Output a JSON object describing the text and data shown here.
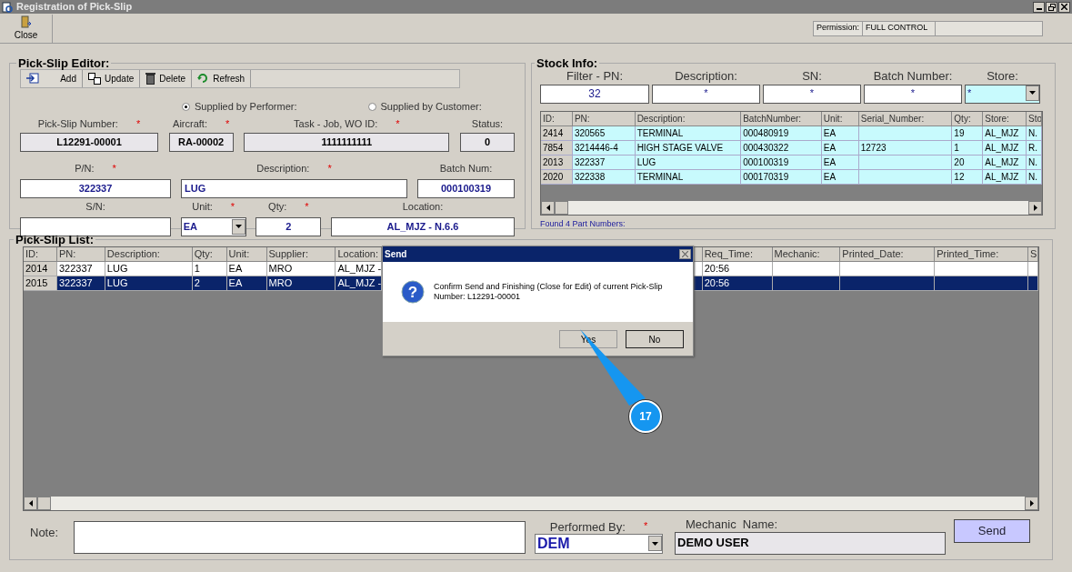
{
  "window": {
    "title": "Registration of Pick-Slip"
  },
  "toolbar": {
    "buttons": [
      {
        "label": "Close"
      }
    ]
  },
  "permission": {
    "label": "Permission:",
    "value": "FULL CONTROL"
  },
  "editor": {
    "title": "Pick-Slip Editor:",
    "actions": [
      {
        "kind": "add",
        "label": "Add"
      },
      {
        "kind": "update",
        "label": "Update"
      },
      {
        "kind": "delete",
        "label": "Delete"
      },
      {
        "kind": "refresh",
        "label": "Refresh"
      }
    ],
    "supply_options": [
      {
        "label": "Supplied by Performer:",
        "selected": true
      },
      {
        "label": "Supplied by Customer:",
        "selected": false
      }
    ],
    "rows": [
      [
        {
          "label": "Pick-Slip Number:",
          "required": true,
          "kind": "readonly",
          "value": "L12291-00001"
        },
        {
          "label": "Aircraft:",
          "required": true,
          "kind": "readonly",
          "value": "RA-00002"
        },
        {
          "label": "Task - Job, WO ID:",
          "required": true,
          "kind": "readonly",
          "value": "1111111111"
        },
        {
          "label": "Status:",
          "required": false,
          "kind": "readonly",
          "value": "0"
        }
      ],
      [
        {
          "label": "P/N:",
          "required": true,
          "kind": "input",
          "value": "322337"
        },
        {
          "label": "Description:",
          "required": true,
          "kind": "input",
          "value": "LUG"
        },
        {
          "label": "Batch Num:",
          "required": false,
          "kind": "input",
          "value": "000100319"
        }
      ],
      [
        {
          "label": "S/N:",
          "required": false,
          "kind": "input"
        },
        {
          "label": "Unit:",
          "required": true,
          "kind": "select",
          "value": "EA"
        },
        {
          "label": "Qty:",
          "required": true,
          "kind": "input",
          "value": "2"
        },
        {
          "label": "Location:",
          "required": false,
          "kind": "input",
          "value": "AL_MJZ - N.6.6"
        }
      ]
    ]
  },
  "stock": {
    "title": "Stock Info:",
    "filters": [
      {
        "label": "Filter - PN:",
        "value": "32",
        "kind": "input"
      },
      {
        "label": "Description:",
        "value": "*",
        "kind": "input"
      },
      {
        "label": "SN:",
        "value": "*",
        "kind": "input"
      },
      {
        "label": "Batch Number:",
        "value": "*",
        "kind": "input"
      },
      {
        "label": "Store:",
        "value": "*",
        "kind": "select"
      }
    ],
    "columns": [
      "ID:",
      "PN:",
      "Description:",
      "BatchNumber:",
      "Unit:",
      "Serial_Number:",
      "Qty:",
      "Store:",
      "Sto"
    ],
    "rows": [
      [
        "2414",
        "320565",
        "TERMINAL",
        "000480919",
        "EA",
        "",
        "19",
        "AL_MJZ",
        "N."
      ],
      [
        "7854",
        "3214446-4",
        "HIGH STAGE VALVE",
        "000430322",
        "EA",
        "12723",
        "1",
        "AL_MJZ",
        "R."
      ],
      [
        "2013",
        "322337",
        "LUG",
        "000100319",
        "EA",
        "",
        "20",
        "AL_MJZ",
        "N."
      ],
      [
        "2020",
        "322338",
        "TERMINAL",
        "000170319",
        "EA",
        "",
        "12",
        "AL_MJZ",
        "N."
      ]
    ],
    "found": "Found 4 Part Numbers:"
  },
  "pick_list": {
    "title": "Pick-Slip List:",
    "columns": [
      "ID:",
      "PN:",
      "Description:",
      "Qty:",
      "Unit:",
      "Supplier:",
      "Location:",
      "",
      "Req_Time:",
      "Mechanic:",
      "Printed_Date:",
      "Printed_Time:",
      "S"
    ],
    "rows": [
      {
        "selected": false,
        "cells": [
          "2014",
          "322337",
          "LUG",
          "1",
          "EA",
          "MRO",
          "AL_MJZ -",
          "",
          "20:56",
          "",
          "",
          "",
          ""
        ]
      },
      {
        "selected": true,
        "cells": [
          "2015",
          "322337",
          "LUG",
          "2",
          "EA",
          "MRO",
          "AL_MJZ -",
          "",
          "20:56",
          "",
          "",
          "",
          ""
        ]
      }
    ]
  },
  "footer": {
    "note_label": "Note:",
    "performed_by": {
      "label": "Performed By:",
      "required": true,
      "value": "DEM"
    },
    "mechanic_name": {
      "label": "Mechanic  Name:",
      "value": "DEMO USER"
    },
    "send": "Send"
  },
  "dialog": {
    "title": "Send",
    "icon": "?",
    "message": "Confirm Send and Finishing (Close for Edit) of current Pick-Slip Number: L12291-00001",
    "buttons": [
      {
        "label": "Yes",
        "default": false
      },
      {
        "label": "No",
        "default": true
      }
    ]
  },
  "callout": "17"
}
